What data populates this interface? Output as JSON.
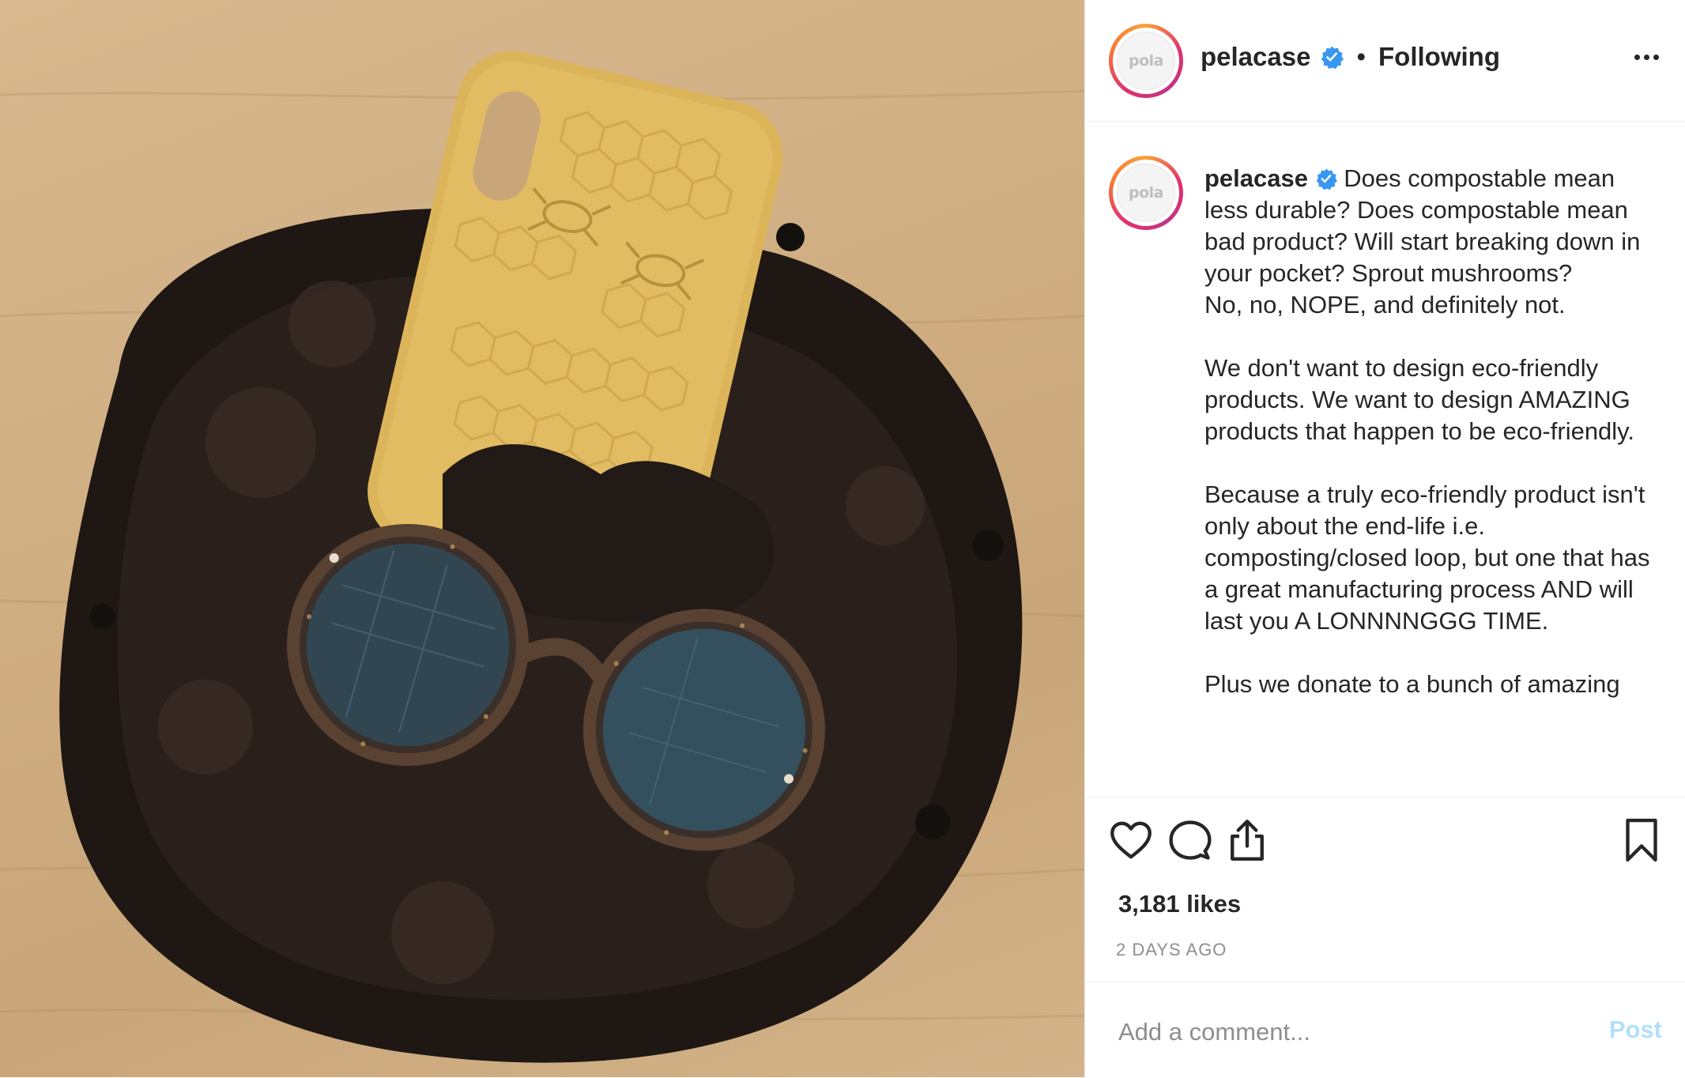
{
  "post": {
    "username": "pelacase",
    "avatar_text": "pola",
    "verified_icon": "verified-badge-icon",
    "separator": "•",
    "follow_status": "Following",
    "more_icon": "more-options-icon"
  },
  "caption": {
    "username": "pelacase",
    "text": "Does compostable mean less durable? Does compostable mean bad product? Will start breaking down in your pocket? Sprout mushrooms?\nNo, no, NOPE, and definitely not.\n\nWe don't want to design eco-friendly products. We want to design AMAZING products that happen to be eco-friendly.\n\nBecause a truly eco-friendly product isn't only about the end-life i.e. composting/closed loop, but one that has a great manufacturing process AND will last you A LONNNNGGG TIME.\n\nPlus we donate to a bunch of amazing"
  },
  "actions": {
    "like_icon": "heart-icon",
    "comment_icon": "comment-bubble-icon",
    "share_icon": "share-icon",
    "save_icon": "bookmark-icon"
  },
  "stats": {
    "likes": "3,181 likes",
    "time_ago": "2 DAYS AGO"
  },
  "comment_box": {
    "placeholder": "Add a comment...",
    "post_label": "Post"
  },
  "colors": {
    "text": "#262626",
    "muted": "#8e8e8e",
    "verified": "#3897f0",
    "post_disabled": "#b2dffc"
  }
}
